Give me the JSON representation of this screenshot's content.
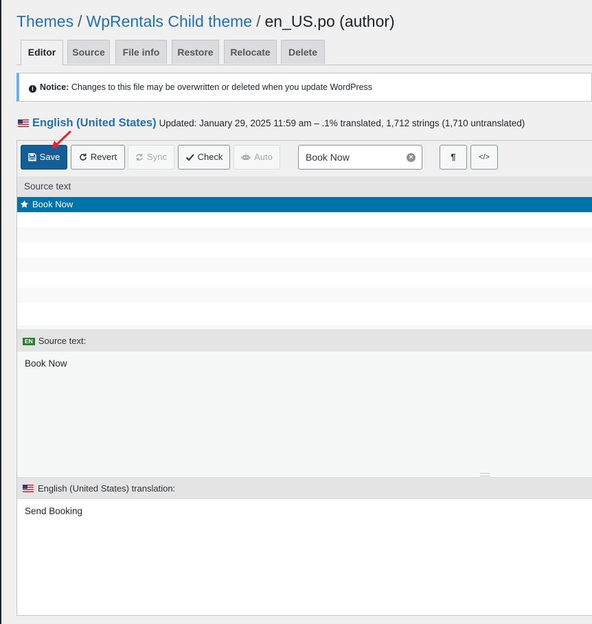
{
  "breadcrumb": {
    "themes": "Themes",
    "theme": "WpRentals Child theme",
    "file": "en_US.po (author)",
    "separator": "/"
  },
  "tabs": [
    "Editor",
    "Source",
    "File info",
    "Restore",
    "Relocate",
    "Delete"
  ],
  "notice": {
    "label": "Notice:",
    "text": "Changes to this file may be overwritten or deleted when you update WordPress"
  },
  "locale": {
    "name": "English (United States)",
    "status": "Updated: January 29, 2025 11:59 am – .1% translated, 1,712 strings (1,710 untranslated)"
  },
  "toolbar": {
    "save": "Save",
    "revert": "Revert",
    "sync": "Sync",
    "check": "Check",
    "auto": "Auto",
    "search_value": "Book Now",
    "pilcrow": "¶",
    "code": "</>"
  },
  "list": {
    "header": "Source text",
    "selected_item": "Book Now"
  },
  "source_panel": {
    "badge": "EN",
    "label": "Source text:",
    "text": "Book Now"
  },
  "translation_panel": {
    "label": "English (United States) translation:",
    "text": "Send Booking"
  },
  "colors": {
    "link": "#2271b1",
    "primary_button": "#135e96",
    "selected_row": "#0073aa",
    "notice_border": "#72aee6",
    "annotation_arrow": "#e8202a"
  }
}
